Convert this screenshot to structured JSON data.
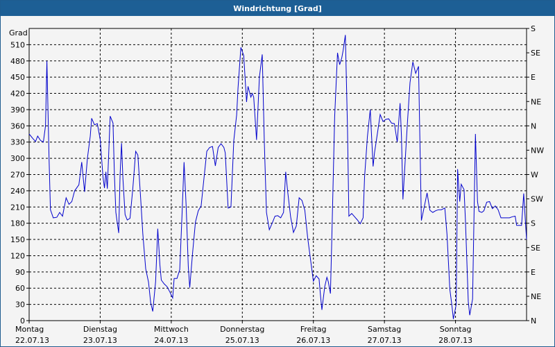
{
  "window": {
    "title": "Windrichtung [Grad]"
  },
  "chart_data": {
    "type": "line",
    "title": "Windrichtung [Grad]",
    "ylabel": "Grad",
    "ylim": [
      0,
      540
    ],
    "yticks": [
      0,
      30,
      60,
      90,
      120,
      150,
      180,
      210,
      240,
      270,
      300,
      330,
      360,
      390,
      420,
      450,
      480,
      510
    ],
    "right_axis": {
      "values": [
        0,
        45,
        90,
        135,
        180,
        225,
        270,
        315,
        360,
        405,
        450,
        495,
        540
      ],
      "labels": [
        "N",
        "NE",
        "E",
        "SE",
        "S",
        "SW",
        "W",
        "NW",
        "N",
        "NE",
        "E",
        "SE",
        "S"
      ]
    },
    "x_axis": {
      "range_days": [
        0,
        7
      ],
      "day_labels": [
        {
          "day": "Montag",
          "date": "22.07.13"
        },
        {
          "day": "Dienstag",
          "date": "23.07.13"
        },
        {
          "day": "Mittwoch",
          "date": "24.07.13"
        },
        {
          "day": "Donnerstag",
          "date": "25.07.13"
        },
        {
          "day": "Freitag",
          "date": "26.07.13"
        },
        {
          "day": "Samstag",
          "date": "27.07.13"
        },
        {
          "day": "Sonntag",
          "date": "28.07.13"
        }
      ]
    },
    "grid": true,
    "series": [
      {
        "color": "#0000cc",
        "points": [
          [
            0.0,
            345
          ],
          [
            0.05,
            337
          ],
          [
            0.09,
            331
          ],
          [
            0.12,
            341
          ],
          [
            0.16,
            333
          ],
          [
            0.2,
            330
          ],
          [
            0.23,
            360
          ],
          [
            0.25,
            480
          ],
          [
            0.28,
            300
          ],
          [
            0.3,
            205
          ],
          [
            0.34,
            190
          ],
          [
            0.39,
            191
          ],
          [
            0.43,
            200
          ],
          [
            0.47,
            193
          ],
          [
            0.52,
            227
          ],
          [
            0.56,
            215
          ],
          [
            0.6,
            220
          ],
          [
            0.64,
            240
          ],
          [
            0.7,
            251
          ],
          [
            0.74,
            293
          ],
          [
            0.78,
            238
          ],
          [
            0.82,
            300
          ],
          [
            0.86,
            341
          ],
          [
            0.88,
            374
          ],
          [
            0.92,
            362
          ],
          [
            0.96,
            364
          ],
          [
            1.0,
            335
          ],
          [
            1.04,
            265
          ],
          [
            1.06,
            245
          ],
          [
            1.08,
            275
          ],
          [
            1.1,
            244
          ],
          [
            1.12,
            309
          ],
          [
            1.14,
            378
          ],
          [
            1.18,
            365
          ],
          [
            1.2,
            270
          ],
          [
            1.22,
            200
          ],
          [
            1.26,
            162
          ],
          [
            1.28,
            270
          ],
          [
            1.3,
            328
          ],
          [
            1.32,
            262
          ],
          [
            1.35,
            196
          ],
          [
            1.38,
            186
          ],
          [
            1.42,
            189
          ],
          [
            1.46,
            245
          ],
          [
            1.5,
            313
          ],
          [
            1.53,
            306
          ],
          [
            1.57,
            225
          ],
          [
            1.6,
            160
          ],
          [
            1.64,
            96
          ],
          [
            1.68,
            71
          ],
          [
            1.71,
            33
          ],
          [
            1.74,
            17
          ],
          [
            1.78,
            72
          ],
          [
            1.81,
            170
          ],
          [
            1.84,
            103
          ],
          [
            1.86,
            75
          ],
          [
            1.9,
            68
          ],
          [
            1.94,
            63
          ],
          [
            1.98,
            53
          ],
          [
            2.02,
            42
          ],
          [
            2.04,
            78
          ],
          [
            2.08,
            78
          ],
          [
            2.12,
            94
          ],
          [
            2.15,
            190
          ],
          [
            2.18,
            293
          ],
          [
            2.21,
            210
          ],
          [
            2.24,
            100
          ],
          [
            2.26,
            61
          ],
          [
            2.3,
            125
          ],
          [
            2.34,
            182
          ],
          [
            2.38,
            203
          ],
          [
            2.42,
            212
          ],
          [
            2.46,
            263
          ],
          [
            2.5,
            313
          ],
          [
            2.54,
            320
          ],
          [
            2.58,
            322
          ],
          [
            2.62,
            286
          ],
          [
            2.66,
            320
          ],
          [
            2.7,
            327
          ],
          [
            2.74,
            320
          ],
          [
            2.76,
            310
          ],
          [
            2.8,
            208
          ],
          [
            2.84,
            210
          ],
          [
            2.88,
            333
          ],
          [
            2.92,
            380
          ],
          [
            2.94,
            430
          ],
          [
            2.98,
            505
          ],
          [
            3.02,
            490
          ],
          [
            3.06,
            404
          ],
          [
            3.08,
            433
          ],
          [
            3.12,
            413
          ],
          [
            3.14,
            420
          ],
          [
            3.16,
            413
          ],
          [
            3.2,
            334
          ],
          [
            3.24,
            450
          ],
          [
            3.28,
            492
          ],
          [
            3.31,
            330
          ],
          [
            3.34,
            200
          ],
          [
            3.38,
            168
          ],
          [
            3.42,
            180
          ],
          [
            3.46,
            193
          ],
          [
            3.5,
            194
          ],
          [
            3.54,
            190
          ],
          [
            3.58,
            200
          ],
          [
            3.61,
            275
          ],
          [
            3.64,
            237
          ],
          [
            3.68,
            192
          ],
          [
            3.72,
            163
          ],
          [
            3.76,
            175
          ],
          [
            3.8,
            227
          ],
          [
            3.84,
            222
          ],
          [
            3.88,
            204
          ],
          [
            3.92,
            153
          ],
          [
            3.96,
            113
          ],
          [
            4.0,
            73
          ],
          [
            4.04,
            83
          ],
          [
            4.08,
            77
          ],
          [
            4.1,
            46
          ],
          [
            4.12,
            20
          ],
          [
            4.16,
            63
          ],
          [
            4.19,
            80
          ],
          [
            4.21,
            72
          ],
          [
            4.24,
            50
          ],
          [
            4.26,
            152
          ],
          [
            4.3,
            377
          ],
          [
            4.34,
            495
          ],
          [
            4.37,
            473
          ],
          [
            4.4,
            486
          ],
          [
            4.42,
            500
          ],
          [
            4.45,
            528
          ],
          [
            4.48,
            355
          ],
          [
            4.5,
            193
          ],
          [
            4.54,
            198
          ],
          [
            4.58,
            192
          ],
          [
            4.62,
            186
          ],
          [
            4.66,
            179
          ],
          [
            4.7,
            190
          ],
          [
            4.72,
            265
          ],
          [
            4.76,
            340
          ],
          [
            4.8,
            390
          ],
          [
            4.84,
            285
          ],
          [
            4.86,
            310
          ],
          [
            4.9,
            345
          ],
          [
            4.94,
            381
          ],
          [
            4.98,
            368
          ],
          [
            5.02,
            372
          ],
          [
            5.06,
            373
          ],
          [
            5.1,
            365
          ],
          [
            5.14,
            364
          ],
          [
            5.18,
            330
          ],
          [
            5.22,
            402
          ],
          [
            5.24,
            340
          ],
          [
            5.26,
            224
          ],
          [
            5.29,
            290
          ],
          [
            5.32,
            358
          ],
          [
            5.36,
            440
          ],
          [
            5.4,
            478
          ],
          [
            5.44,
            457
          ],
          [
            5.48,
            470
          ],
          [
            5.52,
            185
          ],
          [
            5.56,
            210
          ],
          [
            5.6,
            236
          ],
          [
            5.64,
            204
          ],
          [
            5.68,
            200
          ],
          [
            5.72,
            203
          ],
          [
            5.76,
            205
          ],
          [
            5.8,
            205
          ],
          [
            5.85,
            208
          ],
          [
            5.88,
            160
          ],
          [
            5.92,
            58
          ],
          [
            5.95,
            28
          ],
          [
            5.97,
            3
          ],
          [
            6.01,
            30
          ],
          [
            6.03,
            280
          ],
          [
            6.06,
            220
          ],
          [
            6.08,
            252
          ],
          [
            6.12,
            242
          ],
          [
            6.14,
            185
          ],
          [
            6.18,
            35
          ],
          [
            6.2,
            10
          ],
          [
            6.24,
            40
          ],
          [
            6.28,
            345
          ],
          [
            6.31,
            220
          ],
          [
            6.33,
            202
          ],
          [
            6.37,
            200
          ],
          [
            6.4,
            203
          ],
          [
            6.44,
            219
          ],
          [
            6.48,
            220
          ],
          [
            6.52,
            207
          ],
          [
            6.56,
            212
          ],
          [
            6.6,
            205
          ],
          [
            6.64,
            190
          ],
          [
            6.68,
            190
          ],
          [
            6.72,
            190
          ],
          [
            6.76,
            190
          ],
          [
            6.8,
            192
          ],
          [
            6.84,
            193
          ],
          [
            6.86,
            176
          ],
          [
            6.9,
            176
          ],
          [
            6.93,
            176
          ],
          [
            6.96,
            235
          ],
          [
            6.98,
            190
          ],
          [
            7.0,
            150
          ]
        ]
      }
    ]
  }
}
